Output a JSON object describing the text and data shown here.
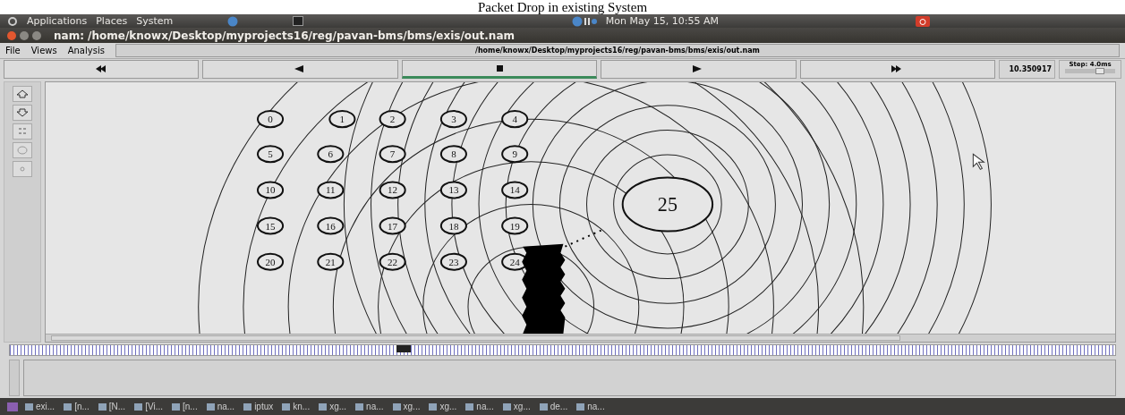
{
  "caption": "Packet Drop in existing System",
  "top_panel": {
    "menus": [
      "Applications",
      "Places",
      "System"
    ],
    "clock": "Mon May 15, 10:55 AM"
  },
  "window": {
    "title": "nam: /home/knowx/Desktop/myprojects16/reg/pavan-bms/bms/exis/out.nam"
  },
  "menu": [
    "File",
    "Views",
    "Analysis"
  ],
  "file_path": "/home/knowx/Desktop/myprojects16/reg/pavan-bms/bms/exis/out.nam",
  "playback": [
    {
      "kind": "rewind",
      "selected": false
    },
    {
      "kind": "back",
      "selected": false
    },
    {
      "kind": "stop",
      "selected": true
    },
    {
      "kind": "play",
      "selected": false
    },
    {
      "kind": "forward",
      "selected": false
    }
  ],
  "time": "10.350917",
  "step": {
    "label": "Step: 4.0ms",
    "level": 0.7
  },
  "nodes": [
    "0",
    "1",
    "2",
    "3",
    "4",
    "5",
    "6",
    "7",
    "8",
    "9",
    "10",
    "11",
    "12",
    "13",
    "14",
    "15",
    "16",
    "17",
    "18",
    "19",
    "20",
    "21",
    "22",
    "23",
    "24",
    "25"
  ],
  "taskbar": [
    "exi...",
    "[n...",
    "[N...",
    "[Vi...",
    "[n...",
    "na...",
    "iptux",
    "kn...",
    "xg...",
    "na...",
    "xg...",
    "xg...",
    "na...",
    "xg...",
    "de...",
    "na..."
  ]
}
